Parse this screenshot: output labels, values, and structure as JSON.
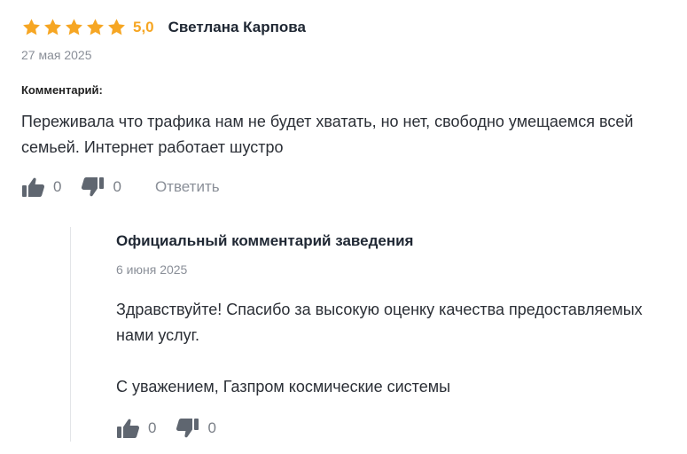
{
  "review": {
    "rating": 5.0,
    "rating_label": "5,0",
    "star_count": 5,
    "author": "Светлана Карпова",
    "date": "27 мая 2025",
    "comment_label": "Комментарий:",
    "comment_text": "Переживала что трафика нам не будет хватать, но нет, свободно умещаемся всей семьей. Интернет работает шустро",
    "likes": "0",
    "dislikes": "0",
    "reply_label": "Ответить"
  },
  "official_reply": {
    "title": "Официальный комментарий заведения",
    "date": "6 июня 2025",
    "paragraph_1": "Здравствуйте! Спасибо за высокую оценку качества предоставляемых нами услуг.",
    "paragraph_2": "С уважением, Газпром космические системы",
    "likes": "0",
    "dislikes": "0"
  },
  "colors": {
    "star": "#f6a623",
    "rating_text": "#f6a623",
    "icon": "#5f6670",
    "muted_text": "#8a8f98",
    "divider": "#e3e5e8"
  },
  "icons": {
    "star": "star-icon",
    "like": "thumbs-up-icon",
    "dislike": "thumbs-down-icon"
  }
}
